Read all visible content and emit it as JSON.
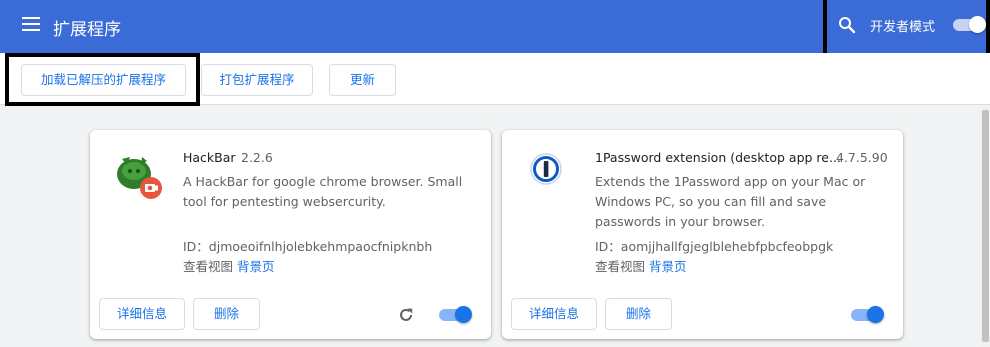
{
  "header": {
    "title": "扩展程序",
    "dev_mode_label": "开发者模式",
    "dev_mode_on": true
  },
  "toolbar": {
    "load_unpacked": "加载已解压的扩展程序",
    "pack": "打包扩展程序",
    "update": "更新"
  },
  "extensions": [
    {
      "name": "HackBar",
      "version": "2.2.6",
      "description": "A HackBar for google chrome browser. Small tool for pentesting webserсurity.",
      "id_text": "ID：djmoeoifnlhjolebkehmpaocfnipknbh",
      "views_label": "查看视图",
      "views_link": "背景页",
      "details_label": "详细信息",
      "remove_label": "删除",
      "enabled": true
    },
    {
      "name": "1Password extension (desktop app re...",
      "version": "4.7.5.90",
      "description": "Extends the 1Password app on your Mac or Windows PC, so you can fill and save passwords in your browser.",
      "id_text": "ID：aomjjhallfgjeglblehebfpbcfeobpgk",
      "views_label": "查看视图",
      "views_link": "背景页",
      "details_label": "详细信息",
      "remove_label": "删除",
      "enabled": true
    }
  ],
  "colors": {
    "header_bg": "#3b6bd6",
    "accent": "#1a73e8",
    "page_bg": "#f1f3f4"
  },
  "icons": {
    "menu": "hamburger-menu-icon",
    "search": "search-icon",
    "reload": "reload-icon",
    "hackbar": "hackbar-logo-icon",
    "onepassword": "1password-logo-icon"
  }
}
